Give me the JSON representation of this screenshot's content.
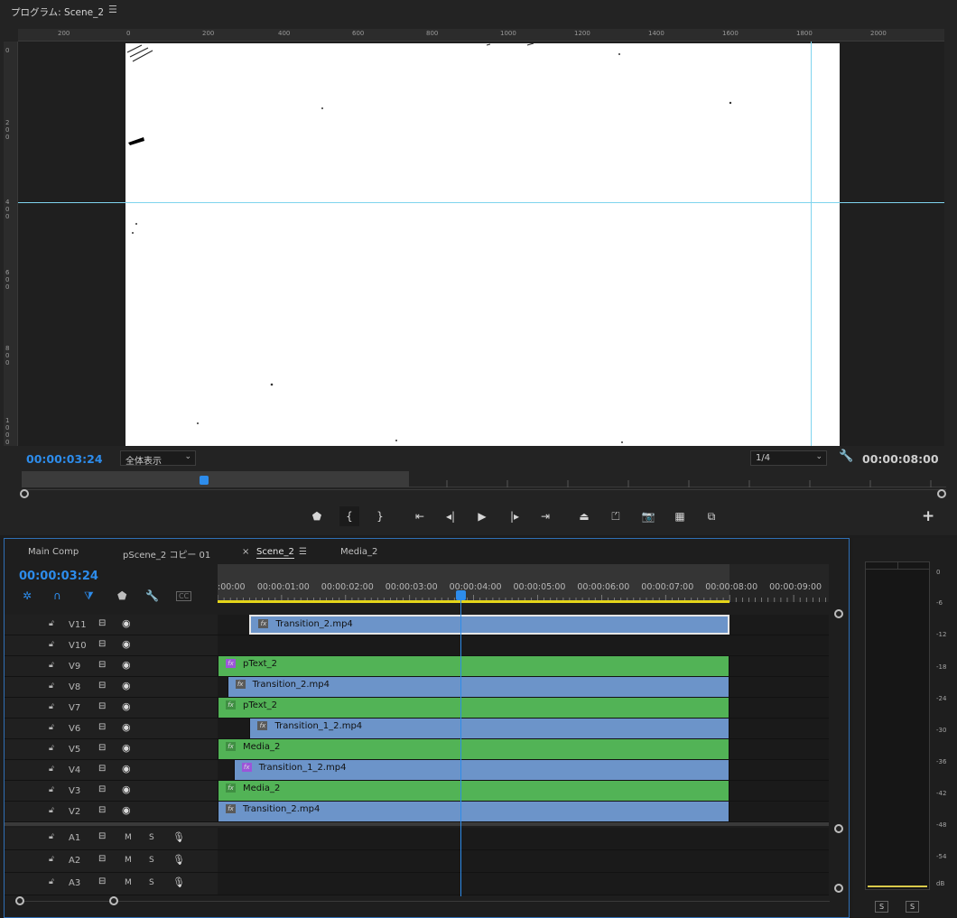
{
  "program": {
    "title": "プログラム: Scene_2",
    "menu_icon": "hamburger-icon",
    "ruler_h": [
      "200",
      "0",
      "200",
      "400",
      "600",
      "800",
      "1000",
      "1200",
      "1400",
      "1600",
      "1800",
      "2000"
    ],
    "ruler_v": [
      "0",
      "200",
      "400",
      "600",
      "800",
      "1000"
    ],
    "timecode": "00:00:03:24",
    "fit": "全体表示",
    "resolution": "1/4",
    "duration": "00:00:08:00",
    "transport_icons": [
      "marker-icon",
      "mark-in-icon",
      "mark-out-icon",
      "go-to-in-icon",
      "step-back-icon",
      "play-icon",
      "step-forward-icon",
      "go-to-out-icon",
      "lift-icon",
      "extract-icon",
      "export-frame-icon",
      "comparison-view-icon",
      "proxy-icon"
    ],
    "add_button": "+",
    "guides_color": "#7fd4ee"
  },
  "timeline": {
    "tabs": [
      {
        "label": "Main Comp",
        "active": false
      },
      {
        "label": "pScene_2 コピー 01",
        "active": false
      },
      {
        "label": "Scene_2",
        "active": true
      },
      {
        "label": "Media_2",
        "active": false
      }
    ],
    "tab_close": "×",
    "timecode": "00:00:03:24",
    "ruler_labels": [
      ":00:00",
      "00:00:01:00",
      "00:00:02:00",
      "00:00:03:00",
      "00:00:04:00",
      "00:00:05:00",
      "00:00:06:00",
      "00:00:07:00",
      "00:00:08:00",
      "00:00:09:00"
    ],
    "playhead_seconds": 3.8,
    "video_tracks": [
      {
        "name": "V11",
        "clips": [
          {
            "label": "Transition_2.mp4",
            "color": "blue",
            "fx": "gray",
            "start": 0.5,
            "end": 8.0,
            "selected": true
          }
        ]
      },
      {
        "name": "V10",
        "clips": []
      },
      {
        "name": "V9",
        "clips": [
          {
            "label": "pText_2",
            "color": "green",
            "fx": "purple",
            "start": 0.0,
            "end": 8.0
          }
        ]
      },
      {
        "name": "V8",
        "clips": [
          {
            "label": "Transition_2.mp4",
            "color": "blue",
            "fx": "gray",
            "start": 0.15,
            "end": 8.0
          }
        ]
      },
      {
        "name": "V7",
        "clips": [
          {
            "label": "pText_2",
            "color": "green",
            "fx": "green",
            "start": 0.0,
            "end": 8.0
          }
        ]
      },
      {
        "name": "V6",
        "clips": [
          {
            "label": "Transition_1_2.mp4",
            "color": "blue",
            "fx": "gray",
            "start": 0.5,
            "end": 8.0
          }
        ]
      },
      {
        "name": "V5",
        "clips": [
          {
            "label": "Media_2",
            "color": "green",
            "fx": "green",
            "start": 0.0,
            "end": 8.0
          }
        ]
      },
      {
        "name": "V4",
        "clips": [
          {
            "label": "Transition_1_2.mp4",
            "color": "blue",
            "fx": "purple",
            "start": 0.25,
            "end": 8.0
          }
        ]
      },
      {
        "name": "V3",
        "clips": [
          {
            "label": "Media_2",
            "color": "green",
            "fx": "green",
            "start": 0.0,
            "end": 8.0
          }
        ]
      },
      {
        "name": "V2",
        "clips": [
          {
            "label": "Transition_2.mp4",
            "color": "blue",
            "fx": "gray",
            "start": 0.0,
            "end": 8.0
          }
        ]
      }
    ],
    "audio_tracks": [
      {
        "name": "A1",
        "m": "M",
        "s": "S"
      },
      {
        "name": "A2",
        "m": "M",
        "s": "S"
      },
      {
        "name": "A3",
        "m": "M",
        "s": "S"
      }
    ],
    "clip_colors": {
      "blue": "#6c94c9",
      "green": "#52b356",
      "playhead": "#2d8ceb",
      "work_area": "#e4d51a"
    }
  },
  "meter": {
    "db_labels": [
      "0",
      "-6",
      "-12",
      "-18",
      "-24",
      "-30",
      "-36",
      "-42",
      "-48",
      "-54",
      "dB"
    ],
    "solo_buttons": [
      "S",
      "S"
    ]
  }
}
